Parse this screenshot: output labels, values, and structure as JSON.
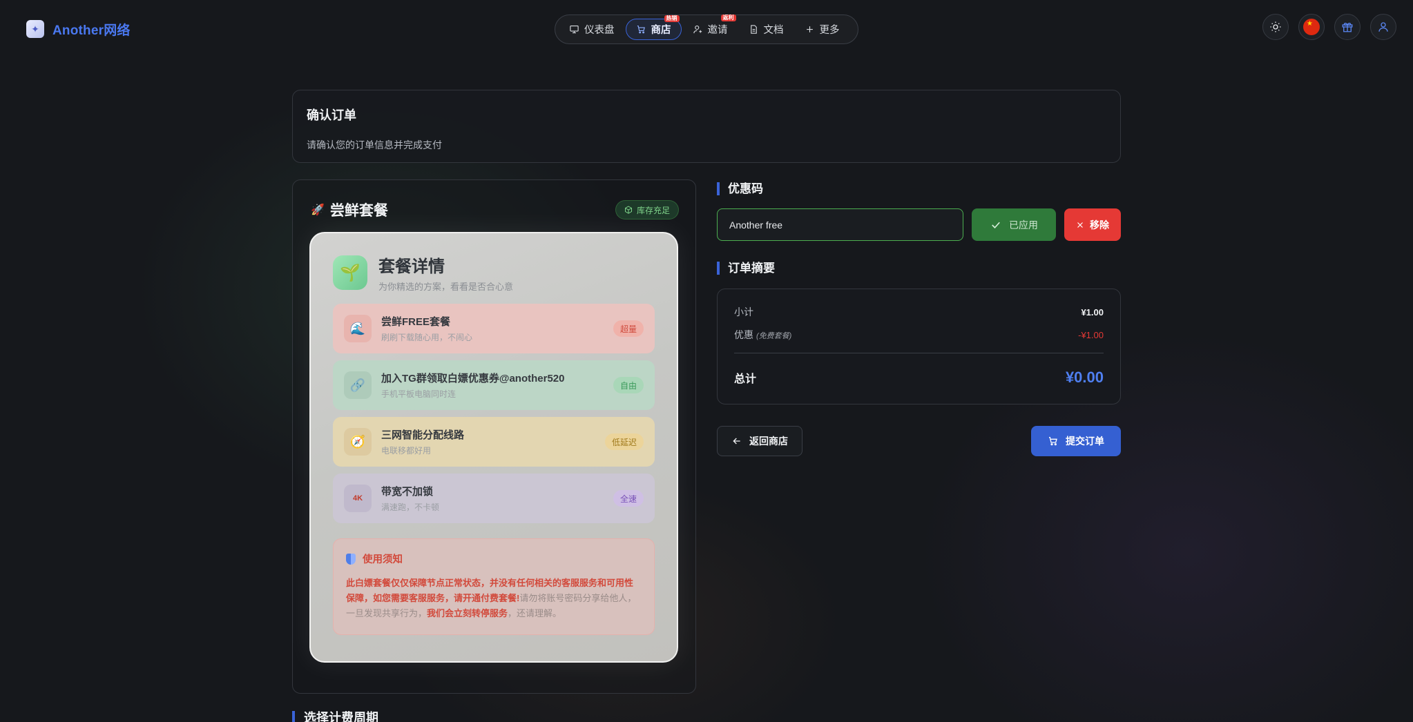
{
  "brand": {
    "name": "Another网络",
    "logo_icon": "app-logo-icon"
  },
  "nav": {
    "items": [
      {
        "label": "仪表盘",
        "icon": "monitor-icon",
        "badge": ""
      },
      {
        "label": "商店",
        "icon": "cart-icon",
        "badge": "热销",
        "active": true
      },
      {
        "label": "邀请",
        "icon": "user-plus-icon",
        "badge": "返利"
      },
      {
        "label": "文档",
        "icon": "document-icon",
        "badge": ""
      },
      {
        "label": "更多",
        "icon": "plus-icon",
        "badge": ""
      }
    ]
  },
  "header_actions": {
    "theme": "sun-icon",
    "language": "china-flag-icon",
    "gift": "gift-icon",
    "user": "user-icon"
  },
  "page": {
    "title": "确认订单",
    "subtitle": "请确认您的订单信息并完成支付"
  },
  "plan": {
    "title": "尝鲜套餐",
    "title_icon": "🚀",
    "stock_label": "库存充足",
    "details": {
      "title": "套餐详情",
      "subtitle": "为你精选的方案，看看是否合心意",
      "icon": "🌱",
      "features": [
        {
          "title": "尝鲜FREE套餐",
          "desc": "刷刷下载随心用，不闹心",
          "tag": "超量",
          "icon": "🌊",
          "color": "red"
        },
        {
          "title": "加入TG群领取白嫖优惠券@another520",
          "desc": "手机平板电脑同时连",
          "tag": "自由",
          "icon": "🔗",
          "color": "green"
        },
        {
          "title": "三网智能分配线路",
          "desc": "电联移都好用",
          "tag": "低延迟",
          "icon": "🧭",
          "color": "yellow"
        },
        {
          "title": "带宽不加锁",
          "desc": "满速跑，不卡顿",
          "tag": "全速",
          "icon": "4K",
          "color": "purple"
        }
      ]
    },
    "notice": {
      "title": "使用须知",
      "strong_part": "此白嫖套餐仅仅保障节点正常状态，并没有任何相关的客服服务和可用性保障，如您需要客服服务，请开通付费套餐!",
      "normal_part_1": "请勿将账号密码分享给他人，一旦发现共享行为，",
      "strong_part_2": "我们会立刻转停服务",
      "normal_part_2": "，还请理解。"
    }
  },
  "next_section": {
    "title": "选择计费周期"
  },
  "coupon": {
    "section_title": "优惠码",
    "value": "Another free",
    "applied_label": "已应用",
    "remove_label": "移除"
  },
  "summary": {
    "section_title": "订单摘要",
    "subtotal_label": "小计",
    "subtotal_value": "¥1.00",
    "discount_label": "优惠",
    "discount_note": "(免费套餐)",
    "discount_value": "-¥1.00",
    "total_label": "总计",
    "total_value": "¥0.00"
  },
  "actions": {
    "back_label": "返回商店",
    "submit_label": "提交订单"
  },
  "colors": {
    "accent": "#3a63d8",
    "success": "#2f7a3a",
    "danger": "#e53935",
    "background": "#16181c"
  }
}
